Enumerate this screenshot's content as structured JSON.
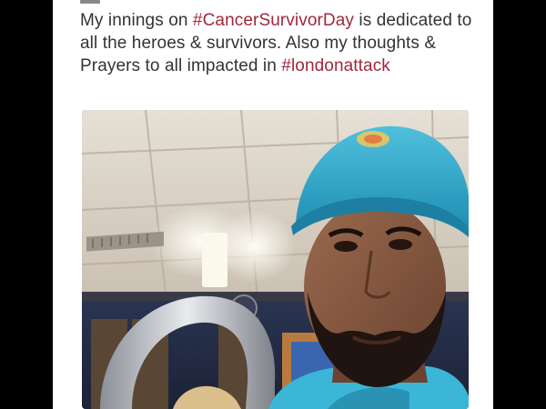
{
  "tweet": {
    "text_part1": "My innings on ",
    "hashtag1": "#CancerSurvivorDay",
    "text_part2": " is dedicated to all the heroes & survivors. Also my thoughts & Prayers to all impacted in ",
    "hashtag2": "#londonattack"
  },
  "media": {
    "description_icon": "selfie-photo",
    "colors": {
      "cap": "#2aa6c8",
      "ceiling": "#d9d2c6",
      "jersey": "#3bb6d6"
    }
  }
}
